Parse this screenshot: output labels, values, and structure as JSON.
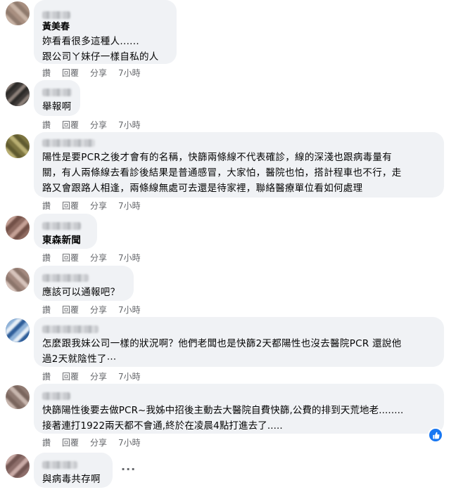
{
  "actions": {
    "like": "讚",
    "reply": "回覆",
    "share": "分享"
  },
  "comments": [
    {
      "author": "黃美春",
      "text": "妳看看很多這種人......\n跟公司ㄚ妹仔一樣自私的人",
      "time": "7小時"
    },
    {
      "author": "",
      "text": "舉報啊",
      "time": "7小時"
    },
    {
      "author": "",
      "text": "陽性是要PCR之後才會有的名稱，快篩兩條線不代表確診，線的深淺也跟病毒量有\n關，有人兩條線去看診後結果是普通感冒，大家怕，醫院也怕，搭計程車也不行，走\n路又會跟路人相逢，兩條線無處可去還是待家裡，聯絡醫療單位看如何處理",
      "time": "7小時"
    },
    {
      "author": "",
      "text": "東森新聞",
      "time": "7小時"
    },
    {
      "author": "",
      "text": "應該可以通報吧？",
      "time": "7小時"
    },
    {
      "author": "",
      "text": "怎麼跟我妹公司一樣的狀況啊？他們老闆也是快篩2天都陽性也沒去醫院PCR 還說他\n過2天就陰性了⋯",
      "time": "7小時"
    },
    {
      "author": "",
      "text": "快篩陽性後要去做PCR~我姊中招後主動去大醫院自費快篩,公費的排到天荒地老........\n接著連打1922兩天都不會通,終於在凌晨4點打進去了.....",
      "time": "7小時"
    },
    {
      "author": "",
      "text": "與病毒共存啊",
      "time": ""
    }
  ],
  "colors": {
    "bubble": "#f0f2f5",
    "meta": "#65676b",
    "like_blue": "#1877f2"
  }
}
